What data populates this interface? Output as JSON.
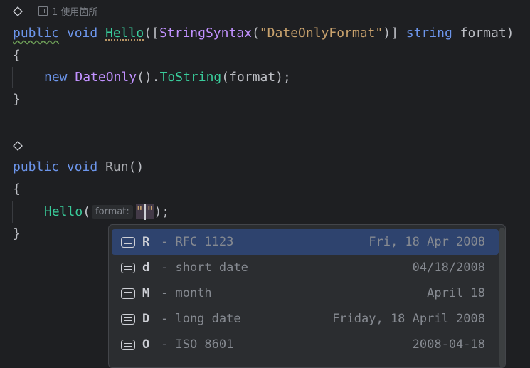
{
  "editor": {
    "usages_label": "1 使用箇所",
    "line1": {
      "kw_public": "public",
      "kw_void": "void",
      "fn_name": "Hello",
      "bracket_open": "([",
      "attr_type": "StringSyntax",
      "paren_open": "(",
      "attr_arg": "\"DateOnlyFormat\"",
      "bracket_close": ")]",
      "kw_string": "string",
      "param": "format)"
    },
    "brace_open": "{",
    "brace_close": "}",
    "line3": {
      "kw_new": "new",
      "type": "DateOnly",
      "call_open": "().",
      "method": "ToString",
      "args": "(format);"
    },
    "line_run": {
      "kw_public": "public",
      "kw_void": "void",
      "fn_name": "Run",
      "parens": "()"
    },
    "line_call": {
      "fn": "Hello",
      "open_paren": "(",
      "hint": "format:",
      "str_open": "\"",
      "str_close": "\"",
      "rest": ");"
    }
  },
  "popup": {
    "items": [
      {
        "key": "R",
        "desc": "- RFC 1123",
        "example": "Fri, 18 Apr 2008",
        "selected": true
      },
      {
        "key": "d",
        "desc": "- short date",
        "example": "04/18/2008",
        "selected": false
      },
      {
        "key": "M",
        "desc": "- month",
        "example": "April 18",
        "selected": false
      },
      {
        "key": "D",
        "desc": "- long date",
        "example": "Friday, 18 April 2008",
        "selected": false
      },
      {
        "key": "O",
        "desc": "- ISO 8601",
        "example": "2008-04-18",
        "selected": false
      }
    ]
  },
  "icons": {
    "gutter": "diamond-outline-icon",
    "usages": "arrow-box-icon",
    "completion": "text-lines-icon"
  },
  "colors": {
    "background": "#1e1f22",
    "keyword": "#6c95eb",
    "type": "#c191ff",
    "function": "#39cc9b",
    "string": "#c9a26d",
    "selection": "#2e436e"
  }
}
